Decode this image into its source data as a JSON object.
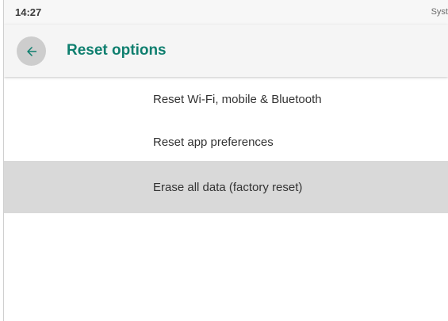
{
  "status_bar": {
    "time": "14:27",
    "right_text": "Syst"
  },
  "app_bar": {
    "back_icon": "arrow-back-icon",
    "title": "Reset options"
  },
  "options": [
    {
      "label": "Reset Wi-Fi, mobile & Bluetooth",
      "highlighted": false
    },
    {
      "label": "Reset app preferences",
      "highlighted": false
    },
    {
      "label": "Erase all data (factory reset)",
      "highlighted": true
    }
  ],
  "colors": {
    "accent": "#0f7f6f",
    "highlight_bg": "#d9d9d9"
  }
}
